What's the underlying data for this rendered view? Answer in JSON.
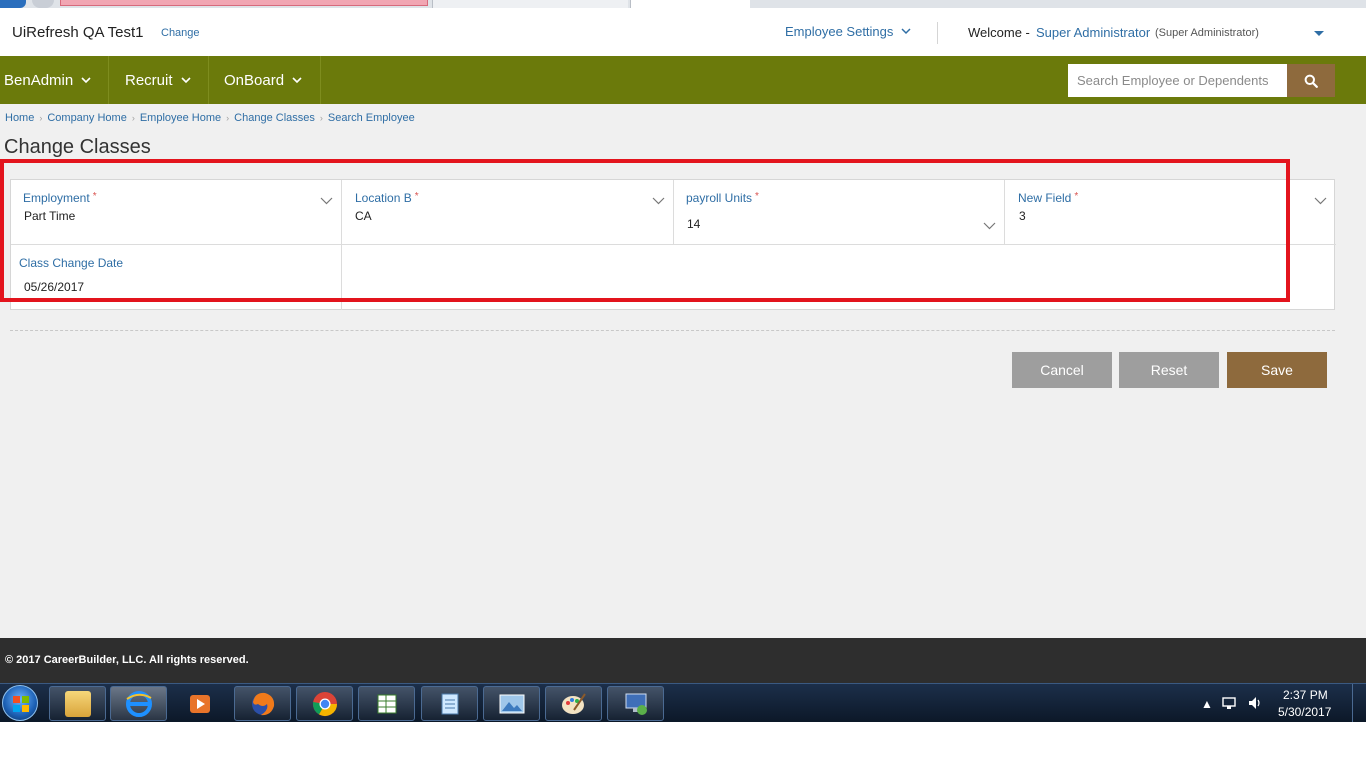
{
  "header": {
    "company": "UiRefresh QA Test1",
    "change_link": "Change",
    "employee_settings": "Employee Settings",
    "welcome": "Welcome -",
    "user_name": "Super Administrator",
    "user_role": "(Super Administrator)"
  },
  "nav": {
    "items": [
      {
        "label": "BenAdmin"
      },
      {
        "label": "Recruit"
      },
      {
        "label": "OnBoard"
      }
    ],
    "search_placeholder": "Search Employee or Dependents",
    "search_icon": "search-icon"
  },
  "breadcrumb": [
    "Home",
    "Company Home",
    "Employee Home",
    "Change Classes",
    "Search Employee"
  ],
  "page_title": "Change Classes",
  "form": {
    "fields": [
      {
        "label": "Employment",
        "required": "*",
        "value": "Part Time"
      },
      {
        "label": "Location B",
        "required": "*",
        "value": "CA"
      },
      {
        "label": "payroll Units",
        "required": "*",
        "value": "14"
      },
      {
        "label": "New Field",
        "required": "*",
        "value": "3"
      }
    ],
    "date_field": {
      "label": "Class Change Date",
      "value": "05/26/2017"
    }
  },
  "buttons": {
    "cancel": "Cancel",
    "reset": "Reset",
    "save": "Save"
  },
  "footer": {
    "copyright": "© 2017 CareerBuilder, LLC. All rights reserved."
  },
  "taskbar": {
    "time": "2:37 PM",
    "date": "5/30/2017",
    "apps": [
      "file-explorer-icon",
      "internet-explorer-icon",
      "media-player-icon",
      "firefox-icon",
      "chrome-icon",
      "spreadsheet-icon",
      "notepad-icon",
      "image-viewer-icon",
      "paint-icon",
      "remote-desktop-icon"
    ]
  },
  "colors": {
    "nav_bg": "#6b7a0b",
    "accent_brown": "#8e6a3d",
    "link_blue": "#2f6ea5",
    "highlight_red": "#e3141d",
    "button_gray": "#9e9e9e"
  }
}
